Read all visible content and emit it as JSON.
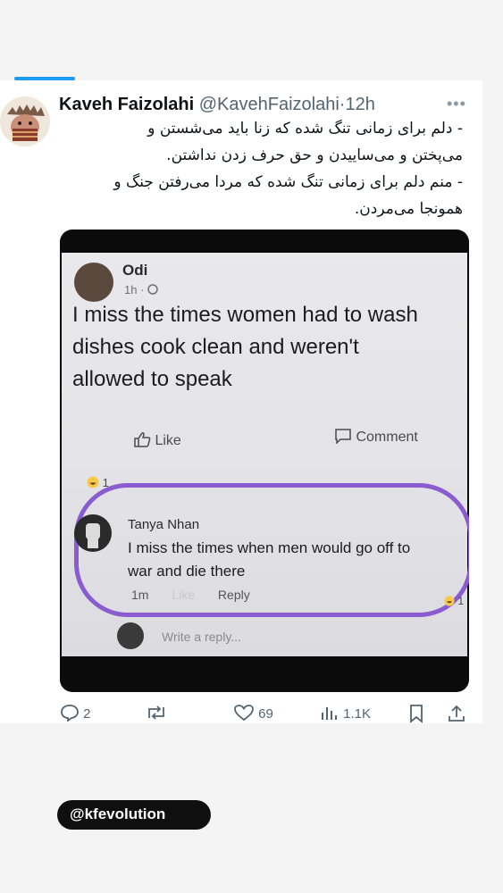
{
  "tweet": {
    "author_name": "Kaveh Faizolahi",
    "handle": "@KavehFaizolahi",
    "separator": "·",
    "time": "12h",
    "more_label": "•••",
    "body_lines": [
      "- دلم برای زمانی تنگ شده که زنا باید می‌شستن و",
      "می‌پختن و می‌ساییدن و حق حرف زدن نداشتن.",
      "- منم دلم برای زمانی تنگ شده که مردا می‌رفتن جنگ و",
      "همونجا می‌مردن."
    ]
  },
  "embedded_post": {
    "author": "Odi",
    "time": "1h ·",
    "text_lines": [
      "I miss the times women had to wash",
      "dishes cook clean and weren't",
      "allowed to speak"
    ],
    "like_label": "Like",
    "comment_label": "Comment",
    "reaction_count": "1",
    "comment": {
      "author": "Tanya Nhan",
      "text_lines": [
        "I miss the times when men would go off to",
        "war and die there"
      ],
      "time": "1m",
      "like_label": "Like",
      "reply_label": "Reply",
      "reaction_count": "1"
    },
    "write_reply_placeholder": "Write a reply..."
  },
  "actions": {
    "replies": "2",
    "likes": "69",
    "views": "1.1K"
  },
  "watermark": "@kfevolution",
  "colors": {
    "accent": "#1d9bf0",
    "highlight_ring": "#8a5cd0"
  }
}
